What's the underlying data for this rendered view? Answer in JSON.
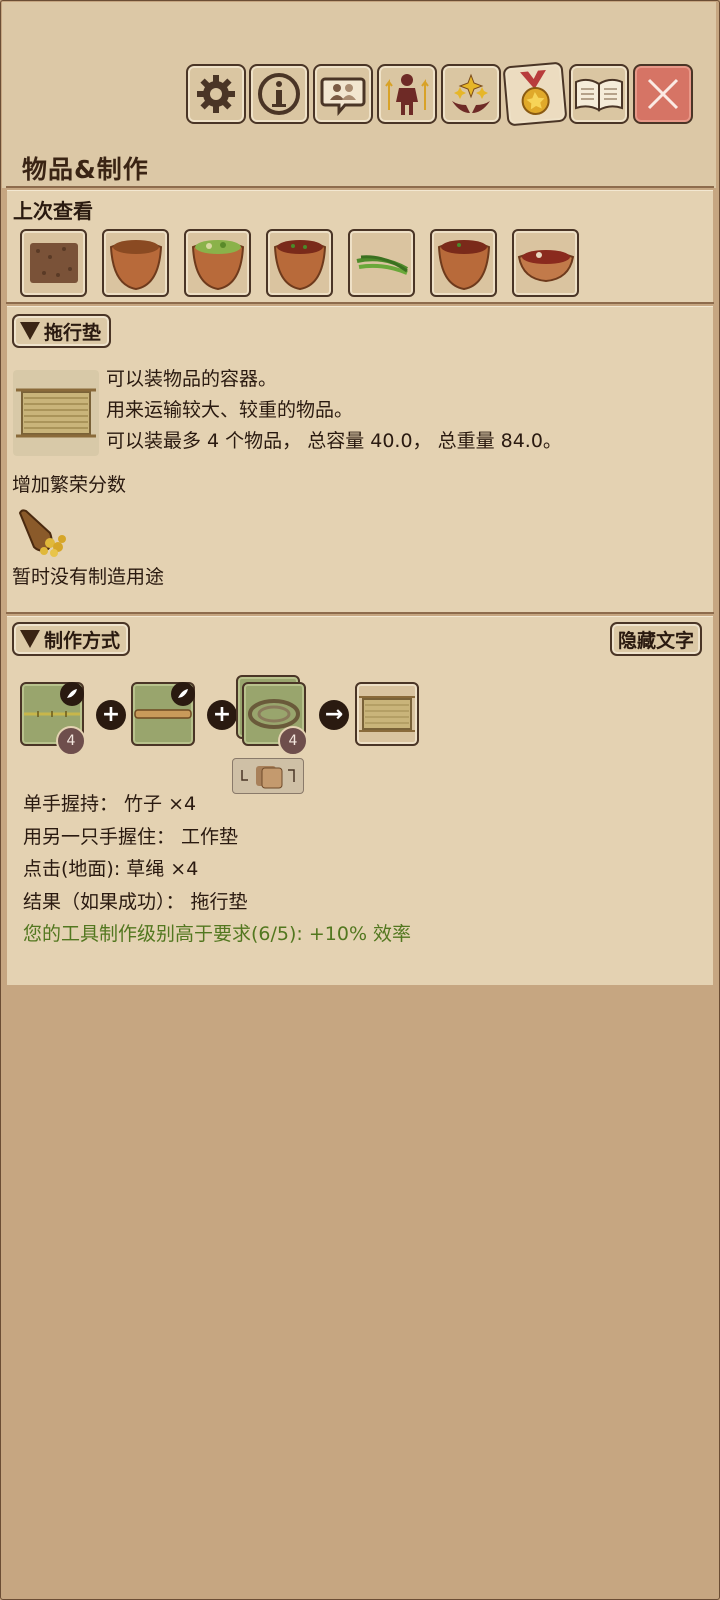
{
  "toolbar": {
    "buttons": [
      {
        "name": "settings",
        "icon": "gear-icon"
      },
      {
        "name": "info",
        "icon": "info-icon"
      },
      {
        "name": "chat",
        "icon": "chat-people-icon"
      },
      {
        "name": "character",
        "icon": "character-icon"
      },
      {
        "name": "skills",
        "icon": "sparkle-hands-icon"
      },
      {
        "name": "achievements",
        "icon": "medal-icon"
      },
      {
        "name": "encyclopedia",
        "icon": "book-icon"
      },
      {
        "name": "close",
        "icon": "close-icon"
      }
    ]
  },
  "page_title": "物品&制作",
  "recent": {
    "title": "上次查看",
    "items": [
      "soil-pile-icon",
      "clay-bowl-icon",
      "bowl-of-greens-icon",
      "bowl-of-stew-icon",
      "green-beans-icon",
      "bowl-of-stew-icon",
      "bowl-of-meat-icon"
    ]
  },
  "item": {
    "name": "拖行垫",
    "desc_line1": "可以装物品的容器。",
    "desc_line2": "用来运输较大、较重的物品。",
    "desc_line3": "可以装最多 4 个物品， 总容量 40.0， 总重量 84.0。",
    "prosperity_label": "增加繁荣分数",
    "no_use_text": "暂时没有制造用途"
  },
  "crafting": {
    "title": "制作方式",
    "hide_text_button": "隐藏文字",
    "ingredient1_count": "4",
    "ingredient3_count": "4",
    "line1": "单手握持： 竹子 ×4",
    "line2": "用另一只手握住： 工作垫",
    "line3": "点击(地面): 草绳 ×4",
    "line4": "结果（如果成功）： 拖行垫",
    "line5": "您的工具制作级别高于要求(6/5): +10% 效率"
  },
  "colors": {
    "background": "#c6a681",
    "panel": "#e4d2b2",
    "close_button": "#d67465",
    "bonus_text": "#52771f",
    "slot_green": "#99a56d"
  }
}
